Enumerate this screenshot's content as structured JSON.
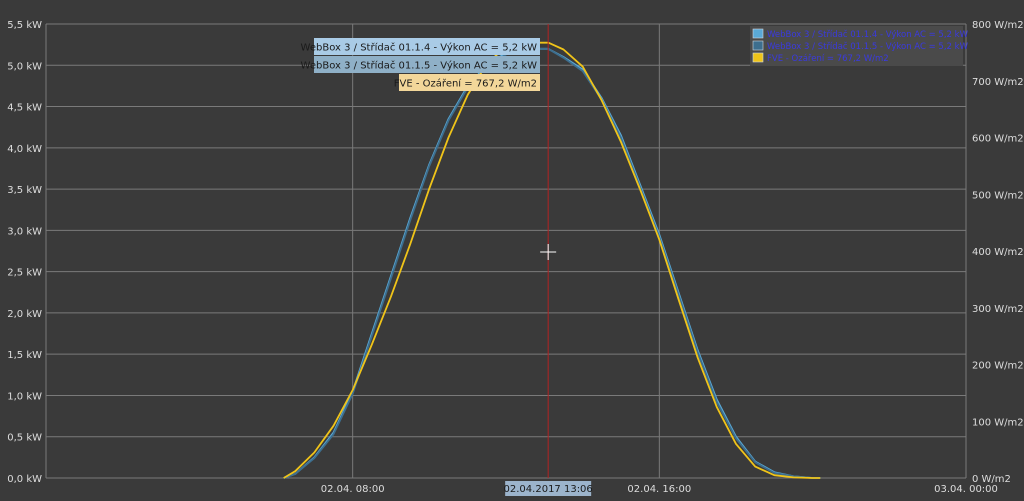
{
  "chart_data": {
    "type": "line",
    "title": "",
    "xlabel": "",
    "ylabel": "",
    "x_ticks": [
      "02.04. 08:00",
      "02.04. 16:00",
      "03.04. 00:00"
    ],
    "x_range": [
      "02.04.2017 00:00",
      "03.04.2017 00:00"
    ],
    "y_left": {
      "ticks": [
        "0,0 kW",
        "0,5 kW",
        "1,0 kW",
        "1,5 kW",
        "2,0 kW",
        "2,5 kW",
        "3,0 kW",
        "3,5 kW",
        "4,0 kW",
        "4,5 kW",
        "5,0 kW",
        "5,5 kW"
      ],
      "range": [
        0,
        5.5
      ]
    },
    "y_right": {
      "ticks": [
        "0 W/m2",
        "100 W/m2",
        "200 W/m2",
        "300 W/m2",
        "400 W/m2",
        "500 W/m2",
        "600 W/m2",
        "700 W/m2",
        "800 W/m2"
      ],
      "range": [
        0,
        800
      ]
    },
    "grid": true,
    "legend_position": "top-right",
    "x_hours": [
      6.2,
      6.5,
      7,
      7.5,
      8,
      8.5,
      9,
      9.5,
      10,
      10.5,
      11,
      11.5,
      12,
      12.5,
      13,
      13.1,
      13.5,
      14,
      14.5,
      15,
      15.5,
      16,
      16.5,
      17,
      17.5,
      18,
      18.5,
      19,
      19.5,
      20,
      20.2
    ],
    "series": [
      {
        "name": "WebBox 3 / Střídač 01.1.4 - Výkon AC = 5,2 kW",
        "axis": "left",
        "color": "#5aa9d6",
        "values": [
          0,
          0.05,
          0.25,
          0.55,
          1.05,
          1.75,
          2.45,
          3.15,
          3.8,
          4.35,
          4.75,
          5.0,
          5.15,
          5.2,
          5.2,
          5.2,
          5.1,
          4.95,
          4.6,
          4.15,
          3.55,
          2.95,
          2.25,
          1.55,
          0.95,
          0.5,
          0.2,
          0.07,
          0.02,
          0,
          0
        ]
      },
      {
        "name": "WebBox 3 / Střídač 01.1.5 - Výkon AC = 5,2 kW",
        "axis": "left",
        "color": "#3d6e8e",
        "values": [
          0,
          0.05,
          0.24,
          0.53,
          1.02,
          1.72,
          2.42,
          3.12,
          3.78,
          4.33,
          4.73,
          4.98,
          5.13,
          5.2,
          5.2,
          5.2,
          5.09,
          4.93,
          4.58,
          4.12,
          3.52,
          2.92,
          2.22,
          1.52,
          0.92,
          0.48,
          0.19,
          0.06,
          0.02,
          0,
          0
        ]
      },
      {
        "name": "FVE - Ozáření = 767,2 W/m2",
        "axis": "right",
        "color": "#f0c419",
        "values": [
          0,
          12,
          45,
          92,
          155,
          235,
          320,
          412,
          510,
          600,
          675,
          730,
          760,
          767,
          767,
          767.2,
          755,
          725,
          665,
          592,
          508,
          420,
          315,
          212,
          125,
          60,
          20,
          5,
          1,
          0,
          0
        ]
      }
    ],
    "cursor": {
      "hour": 13.1,
      "label": "02.04.2017 13:06",
      "tooltips": [
        "WebBox 3 / Střídač 01.1.4 - Výkon AC = 5,2 kW",
        "WebBox 3 / Střídač 01.1.5 - Výkon AC = 5,2 kW",
        "FVE - Ozáření = 767,2 W/m2"
      ]
    }
  },
  "colors": {
    "background": "#3a3a3a",
    "grid": "#7a7a7a",
    "axis_text": "#dddddd",
    "cursor": "#b22222",
    "crosshair": "#ffffff",
    "legend_text": "#3a3adf",
    "legend_bg": "#4a4a4a",
    "tooltip_blue_bg": "#a9cbe6",
    "tooltip_blue2_bg": "#8fb0c7",
    "tooltip_yellow_bg": "#f3d79a",
    "cursor_label_bg": "#9cb4cc"
  }
}
